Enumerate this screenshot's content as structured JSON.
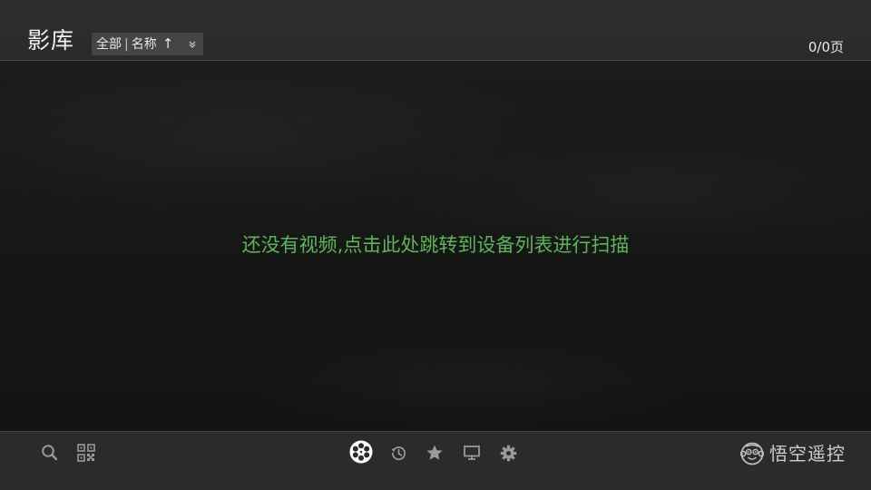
{
  "header": {
    "title": "影库",
    "filter": {
      "category": "全部",
      "separator": "|",
      "sort_field": "名称",
      "sort_arrow": "↑"
    },
    "page_count": "0/0页"
  },
  "main": {
    "empty_message": "还没有视频,点击此处跳转到设备列表进行扫描"
  },
  "footer": {
    "left_icons": [
      "search-icon",
      "qr-code-icon"
    ],
    "nav_icons": [
      "film-reel-icon",
      "history-icon",
      "star-icon",
      "monitor-icon",
      "gear-icon"
    ],
    "active_nav": "film-reel-icon",
    "brand_name": "悟空遥控"
  },
  "colors": {
    "accent_text": "#5fb35a",
    "header_bg": "#2e2e2e",
    "footer_bg": "#2b2b2b",
    "icon_gray": "#9a9a9a",
    "icon_active": "#ffffff"
  }
}
